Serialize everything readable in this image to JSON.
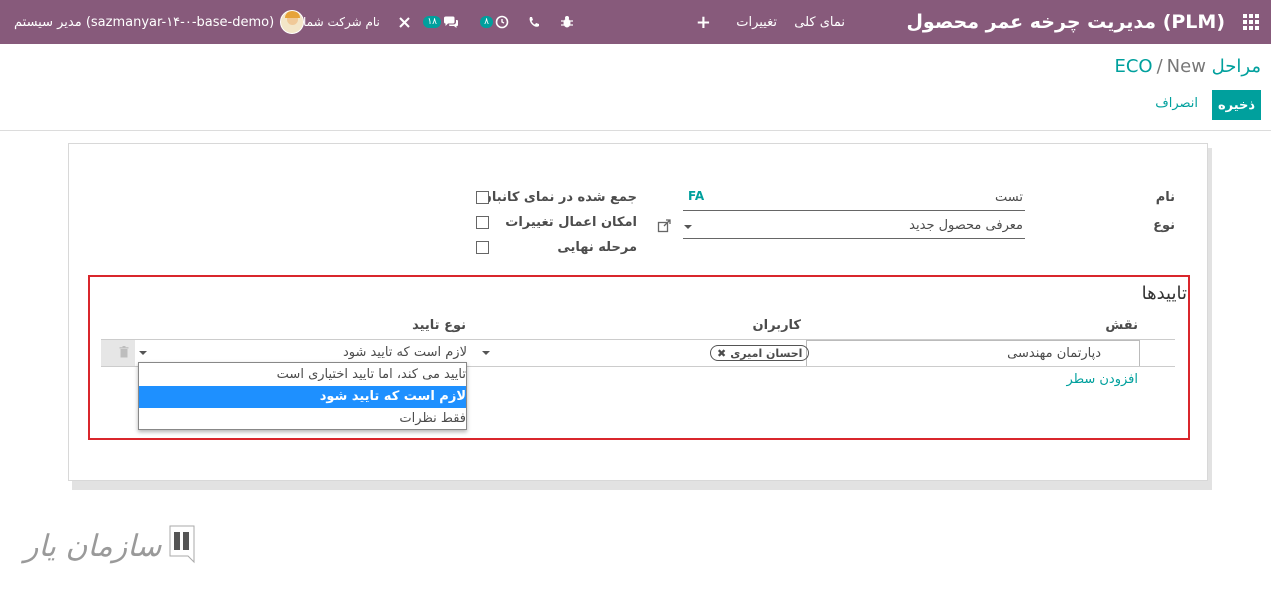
{
  "navbar": {
    "app_title": "مدیریت چرخه عمر محصول (PLM)",
    "menu_overview": "نمای کلی",
    "menu_changes": "تغییرات",
    "messages_count": "۱۸",
    "activities_count": "۸",
    "company_name": "نام شرکت شما",
    "user_label": "مدیر سیستم (sazmanyar-۱۴-۰-base-demo)"
  },
  "breadcrumb": {
    "parent": "مراحل ECO",
    "separator": "/",
    "current": "New"
  },
  "buttons": {
    "save": "ذخیره",
    "discard": "انصراف"
  },
  "form": {
    "name_label": "نام",
    "name_value": "تست",
    "lang_badge": "FA",
    "type_label": "نوع",
    "type_value": "معرفی محصول جدید",
    "folded_label": "جمع شده در نمای کانبان",
    "allow_apply_label": "امکان اعمال تغییرات",
    "final_stage_label": "مرحله نهایی"
  },
  "approvals": {
    "title": "تاییدها",
    "columns": {
      "role": "نقش",
      "users": "کاربران",
      "approval_type": "نوع تایید"
    },
    "row": {
      "role": "دپارتمان مهندسی",
      "user_tag": "احسان امیری",
      "approval_type": "لازم است که تایید شود"
    },
    "add_line": "افزودن سطر",
    "dropdown_options": [
      "تایید می کند، اما تایید اختیاری است",
      "لازم است که تایید شود",
      "فقط نظرات"
    ],
    "dropdown_selected_index": 1
  },
  "watermark": {
    "text": "سازمان یار"
  },
  "colors": {
    "navbar": "#875a7b",
    "accent": "#00a09d",
    "frame": "#d9262c",
    "highlight": "#1e90ff"
  }
}
